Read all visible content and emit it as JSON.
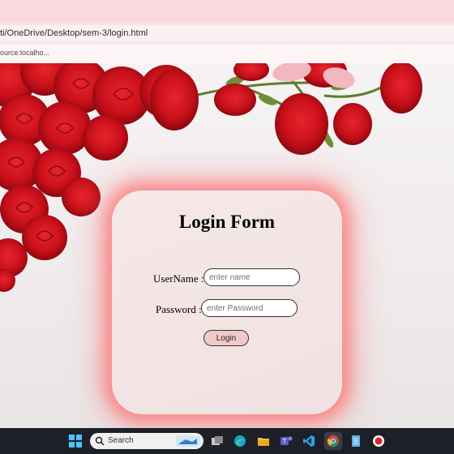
{
  "browser": {
    "url": "ti/OneDrive/Desktop/sem-3/login.html",
    "bookmark": "ource:localho..."
  },
  "form": {
    "title": "Login Form",
    "username_label": "UserName :-",
    "username_placeholder": "enter name",
    "username_value": "",
    "password_label": "Password :-",
    "password_placeholder": "enter Password",
    "password_value": "",
    "login_button": "Login"
  },
  "taskbar": {
    "search_placeholder": "Search",
    "icons": [
      "windows-start-icon",
      "search-icon",
      "task-view-icon",
      "edge-icon",
      "file-explorer-icon",
      "teams-icon",
      "vscode-icon",
      "chrome-icon",
      "notepad-icon",
      "record-icon"
    ]
  },
  "colors": {
    "card_glow": "#ff5a5a",
    "card_bg": "#f4e6e5",
    "button_bg": "#f0c9c9",
    "rose": "#d3141d"
  }
}
